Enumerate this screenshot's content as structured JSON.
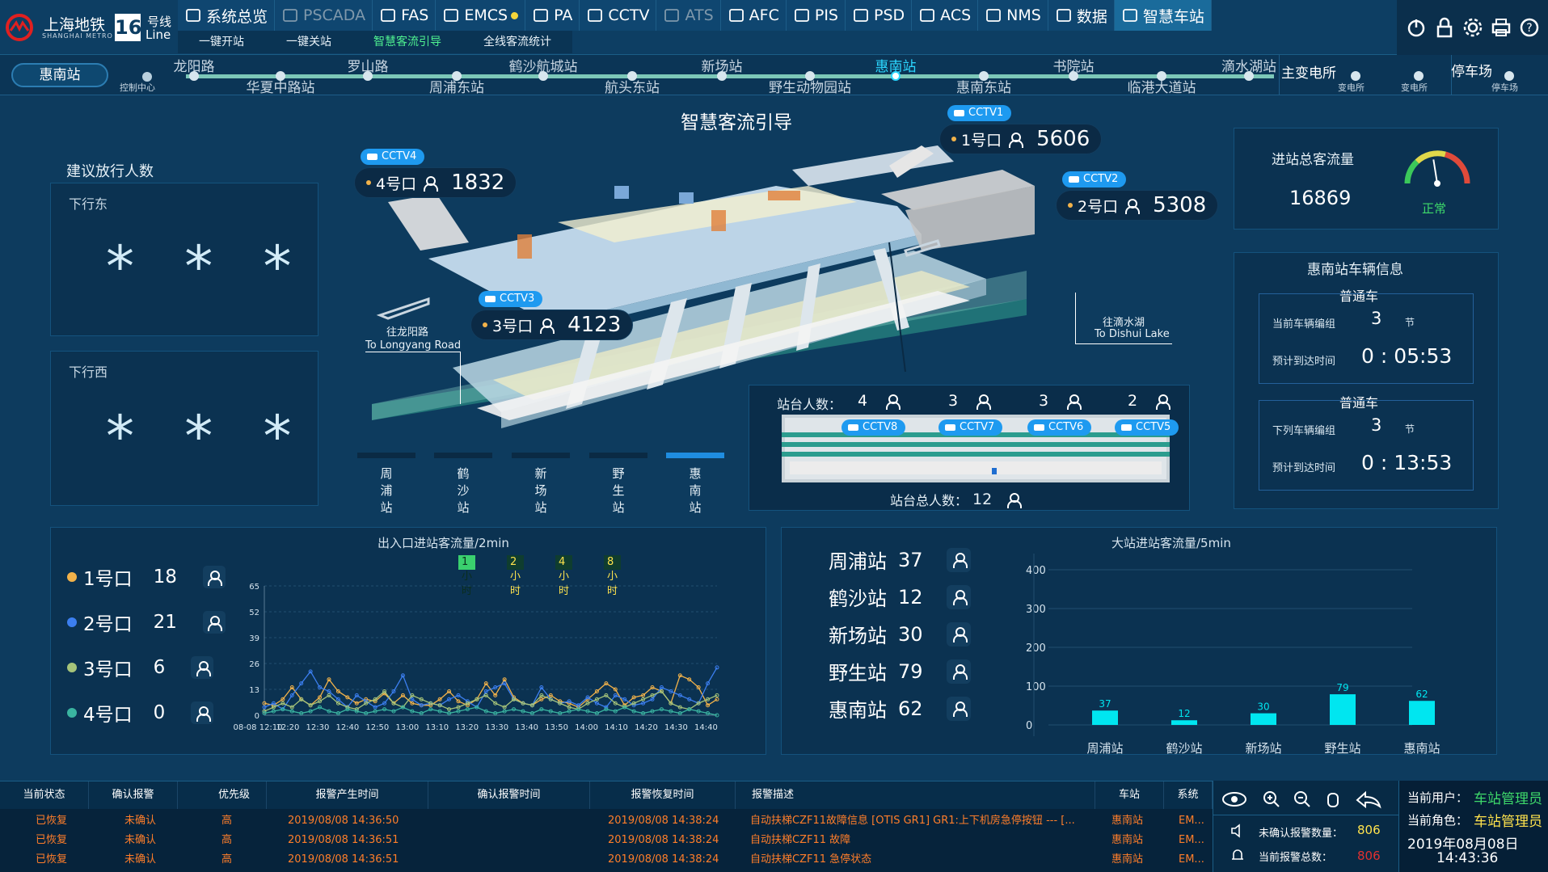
{
  "header": {
    "logo_cn": "上海地铁",
    "logo_en": "SHANGHAI METRO",
    "line_num": "16",
    "line_cn": "号线",
    "line_en": "Line"
  },
  "nav_tabs": [
    {
      "label": "系统总览",
      "icon": "monitor-icon"
    },
    {
      "label": "PSCADA",
      "icon": "power-icon",
      "dim": true
    },
    {
      "label": "FAS",
      "icon": "fire-icon"
    },
    {
      "label": "EMCS",
      "icon": "gear-icon"
    },
    {
      "label": "PA",
      "icon": "speaker-icon"
    },
    {
      "label": "CCTV",
      "icon": "camera-icon"
    },
    {
      "label": "ATS",
      "icon": "train-icon",
      "dim": true
    },
    {
      "label": "AFC",
      "icon": "card-icon"
    },
    {
      "label": "PIS",
      "icon": "person-icon"
    },
    {
      "label": "PSD",
      "icon": "door-icon"
    },
    {
      "label": "ACS",
      "icon": "key-icon"
    },
    {
      "label": "NMS",
      "icon": "network-icon"
    },
    {
      "label": "数据",
      "icon": "chart-icon"
    },
    {
      "label": "智慧车站",
      "icon": "smart-icon",
      "active": true
    }
  ],
  "sub_tabs": [
    "一键开站",
    "一键关站",
    "智慧客流引导",
    "全线客流统计"
  ],
  "station_bar": {
    "current": "惠南站",
    "control": "控制中心",
    "upper": [
      "龙阳路",
      "罗山路",
      "鹤沙航城站",
      "新场站",
      "惠南站",
      "书院站",
      "滴水湖站"
    ],
    "lower": [
      "华夏中路站",
      "周浦东站",
      "航头东站",
      "野生动物园站",
      "惠南东站",
      "临港大道站"
    ],
    "substation": "主变电所",
    "sub_items": [
      "变电所",
      "变电所"
    ],
    "depot": "停车场",
    "depot_sub": "停车场"
  },
  "main_title": "智慧客流引导",
  "left_panel": {
    "title": "建议放行人数",
    "east_label": "下行东",
    "east_value": "* * *",
    "west_label": "下行西",
    "west_value": "* * *"
  },
  "cameras": {
    "c1": "CCTV1",
    "c2": "CCTV2",
    "c3": "CCTV3",
    "c4": "CCTV4",
    "c5": "CCTV5",
    "c6": "CCTV6",
    "c7": "CCTV7",
    "c8": "CCTV8"
  },
  "entrances": {
    "e1": {
      "label": "1号口",
      "value": "5606"
    },
    "e2": {
      "label": "2号口",
      "value": "5308"
    },
    "e3": {
      "label": "3号口",
      "value": "4123"
    },
    "e4": {
      "label": "4号口",
      "value": "1832"
    }
  },
  "directions": {
    "left_cn": "往龙阳路",
    "left_en": "To Longyang Road",
    "right_cn": "往滴水湖",
    "right_en": "To Dishui Lake"
  },
  "bottom_stations": [
    "周浦站",
    "鹤沙站",
    "新场站",
    "野生站",
    "惠南站"
  ],
  "platform": {
    "label": "站台人数：",
    "counts": [
      "4",
      "3",
      "3",
      "2"
    ],
    "total_label": "站台总人数：",
    "total": "12"
  },
  "total_flow": {
    "label": "进站总客流量",
    "value": "16869",
    "status": "正常",
    "gauge_level": 0.45
  },
  "vehicle": {
    "title": "惠南站车辆信息",
    "car1_title": "普通车",
    "car1_group_lbl": "当前车辆编组",
    "car1_group": "3",
    "unit": "节",
    "car1_eta_lbl": "预计到达时间",
    "car1_eta": "0 : 05:53",
    "car2_title": "普通车",
    "car2_group_lbl": "下列车辆编组",
    "car2_group": "3",
    "car2_eta_lbl": "预计到达时间",
    "car2_eta": "0 : 13:53"
  },
  "colors": {
    "entrance1": "#f2b24a",
    "entrance2": "#3c7ff0",
    "entrance3": "#a6c47a",
    "entrance4": "#3ab4a0",
    "bar": "#00e6f0",
    "accent": "#2bd6ff"
  },
  "flow_panel": {
    "title": "出入口进站客流量/2min",
    "time_buttons": [
      "1小时",
      "2小时",
      "4小时",
      "8小时"
    ],
    "legend": [
      {
        "label": "1号口",
        "value": "18"
      },
      {
        "label": "2号口",
        "value": "21"
      },
      {
        "label": "3号口",
        "value": "6"
      },
      {
        "label": "4号口",
        "value": "0"
      }
    ]
  },
  "station_panel": {
    "title": "大站进站客流量/5min",
    "rows": [
      {
        "label": "周浦站",
        "value": "37"
      },
      {
        "label": "鹤沙站",
        "value": "12"
      },
      {
        "label": "新场站",
        "value": "30"
      },
      {
        "label": "野生站",
        "value": "79"
      },
      {
        "label": "惠南站",
        "value": "62"
      }
    ]
  },
  "chart_data": [
    {
      "type": "line",
      "title": "出入口进站客流量/2min",
      "x": [
        "08-08 12:10",
        "12:20",
        "12:30",
        "12:40",
        "12:50",
        "13:00",
        "13:10",
        "13:20",
        "13:30",
        "13:40",
        "13:50",
        "14:00",
        "14:10",
        "14:20",
        "14:30",
        "14:40"
      ],
      "yticks": [
        0,
        13,
        26,
        39,
        52,
        65
      ],
      "ylim": [
        0,
        65
      ],
      "series": [
        {
          "name": "1号口",
          "color": "#f2b24a",
          "values": [
            6,
            5,
            8,
            14,
            8,
            5,
            9,
            18,
            12,
            9,
            6,
            8,
            7,
            11,
            6,
            10,
            6,
            5,
            5,
            8,
            12,
            7,
            5,
            8,
            16,
            10,
            18,
            9,
            6,
            5,
            8,
            10,
            7,
            6,
            4,
            8,
            12,
            16,
            13,
            5,
            9,
            10,
            14,
            12,
            6,
            20,
            18,
            14,
            5,
            8
          ]
        },
        {
          "name": "2号口",
          "color": "#3c7ff0",
          "values": [
            4,
            6,
            3,
            10,
            16,
            22,
            14,
            12,
            8,
            4,
            10,
            7,
            4,
            6,
            12,
            20,
            8,
            5,
            6,
            5,
            8,
            10,
            7,
            4,
            12,
            14,
            16,
            8,
            6,
            5,
            14,
            8,
            6,
            7,
            5,
            9,
            6,
            4,
            10,
            8,
            5,
            6,
            8,
            14,
            12,
            10,
            8,
            6,
            16,
            24
          ]
        },
        {
          "name": "3号口",
          "color": "#a6c47a",
          "values": [
            2,
            4,
            6,
            4,
            8,
            5,
            7,
            10,
            6,
            4,
            3,
            6,
            8,
            12,
            6,
            4,
            10,
            8,
            6,
            5,
            3,
            4,
            6,
            8,
            10,
            6,
            4,
            8,
            6,
            5,
            10,
            8,
            6,
            4,
            3,
            6,
            8,
            10,
            6,
            4,
            6,
            8,
            10,
            12,
            6,
            4,
            3,
            6,
            8,
            10
          ]
        },
        {
          "name": "4号口",
          "color": "#3ab4a0",
          "values": [
            1,
            2,
            3,
            2,
            1,
            2,
            4,
            2,
            1,
            3,
            2,
            1,
            2,
            3,
            2,
            4,
            2,
            1,
            3,
            2,
            1,
            2,
            3,
            4,
            2,
            1,
            2,
            3,
            2,
            1,
            3,
            2,
            1,
            2,
            3,
            2,
            1,
            3,
            2,
            4,
            2,
            1,
            2,
            3,
            2,
            1,
            3,
            2,
            1,
            0
          ]
        }
      ]
    },
    {
      "type": "bar",
      "title": "大站进站客流量/5min",
      "categories": [
        "周浦站",
        "鹤沙站",
        "新场站",
        "野生站",
        "惠南站"
      ],
      "values": [
        37,
        12,
        30,
        79,
        62
      ],
      "yticks": [
        0,
        100,
        200,
        300,
        400
      ],
      "ylim": [
        0,
        400
      ]
    }
  ],
  "alarm": {
    "headers": [
      "当前状态",
      "确认报警",
      "优先级",
      "报警产生时间",
      "确认报警时间",
      "报警恢复时间",
      "报警描述",
      "车站",
      "系统"
    ],
    "rows": [
      [
        "已恢复",
        "未确认",
        "高",
        "2019/08/08 14:36:50",
        "",
        "2019/08/08 14:38:24",
        "自动扶梯CZF11故障信息 [OTIS GR1] GR1:上下机房急停按钮 --- [...",
        "惠南站",
        "EM..."
      ],
      [
        "已恢复",
        "未确认",
        "高",
        "2019/08/08 14:36:51",
        "",
        "2019/08/08 14:38:24",
        "自动扶梯CZF11 故障",
        "惠南站",
        "EM..."
      ],
      [
        "已恢复",
        "未确认",
        "高",
        "2019/08/08 14:36:51",
        "",
        "2019/08/08 14:38:24",
        "自动扶梯CZF11 急停状态",
        "惠南站",
        "EM..."
      ]
    ],
    "unconfirmed_lbl": "未确认报警数量：",
    "unconfirmed": "806",
    "total_lbl": "当前报警总数：",
    "total": "806"
  },
  "user": {
    "user_lbl": "当前用户：",
    "user": "车站管理员",
    "role_lbl": "当前角色：",
    "role": "车站管理员",
    "date": "2019年08月08日",
    "time": "14:43:36"
  }
}
